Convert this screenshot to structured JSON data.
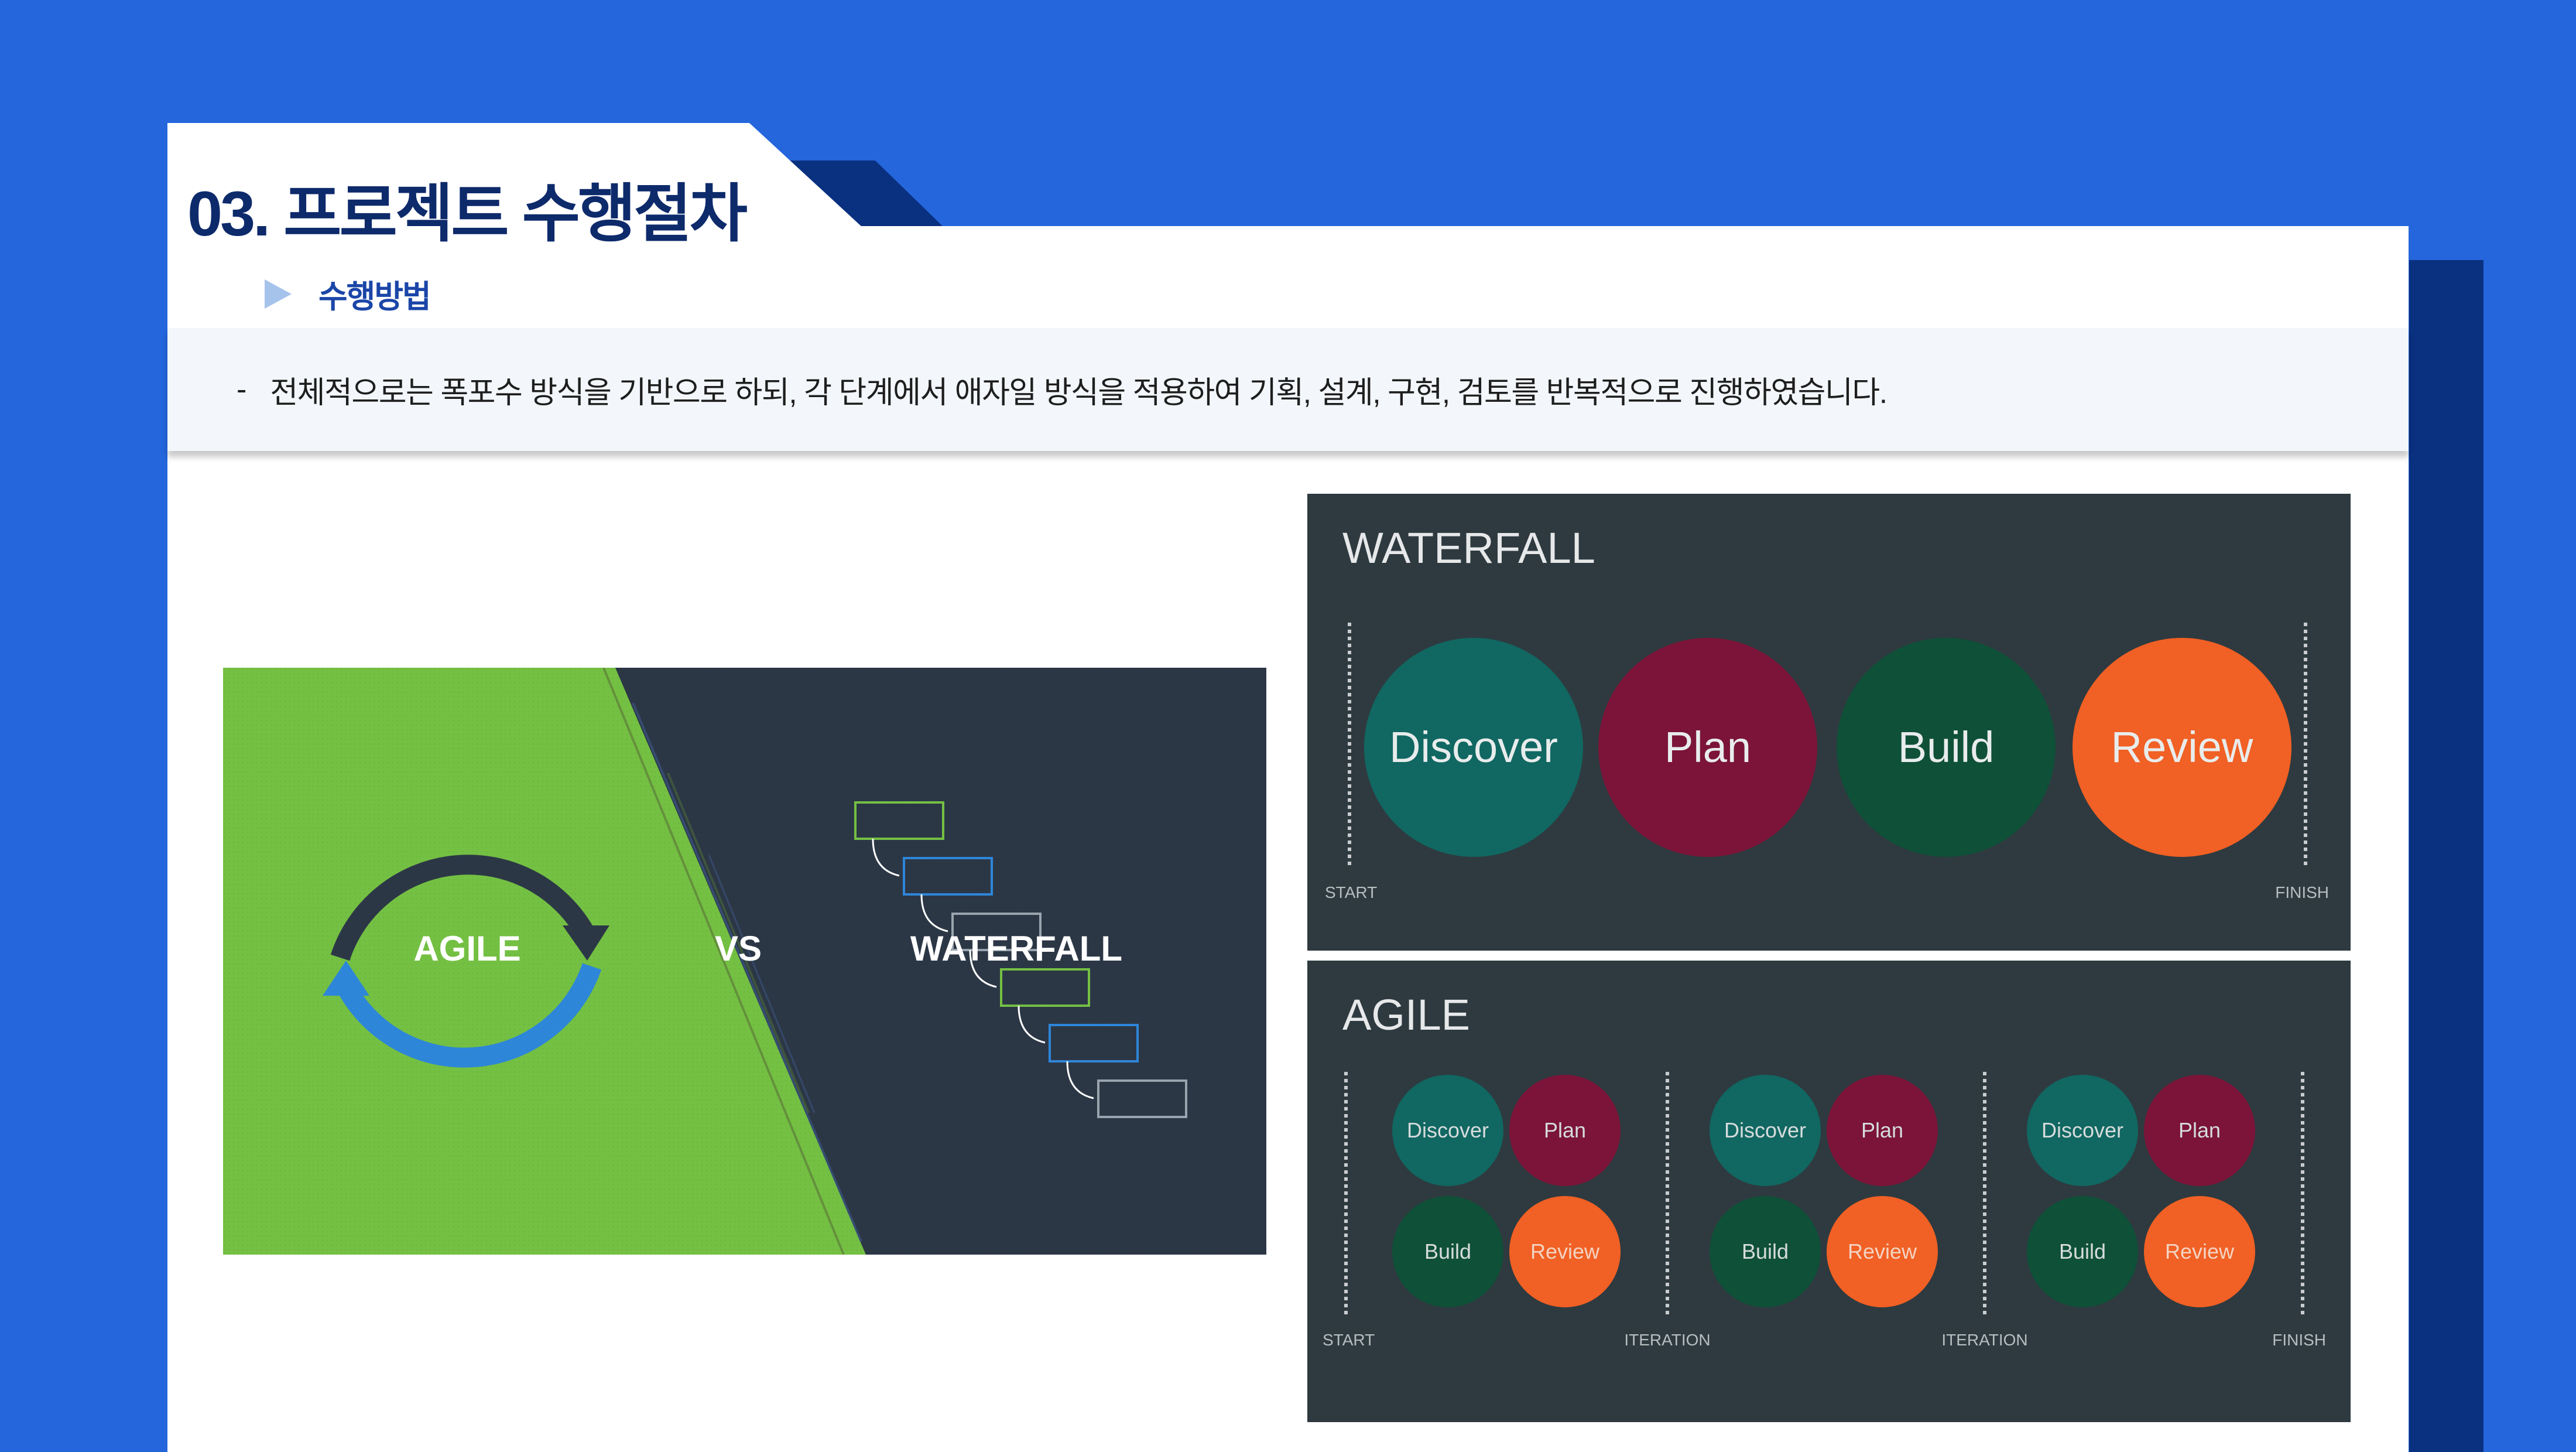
{
  "header": {
    "title": "03. 프로젝트 수행절차",
    "subtitle": "수행방법"
  },
  "description": {
    "bullet": "-",
    "text": "전체적으로는 폭포수 방식을 기반으로 하되, 각 단계에서 애자일 방식을 적용하여 기획, 설계, 구현, 검토를 반복적으로 진행하였습니다."
  },
  "agile_vs_waterfall_image": {
    "left_label": "AGILE",
    "middle_label": "VS",
    "right_label": "WATERFALL",
    "colors": {
      "green": "#74C043",
      "dark": "#2C3746",
      "cycle_dark": "#2C3746",
      "cycle_blue": "#2E86D9"
    }
  },
  "waterfall_panel": {
    "title": "WATERFALL",
    "start_label": "START",
    "finish_label": "FINISH",
    "phases": [
      {
        "name": "Discover",
        "color": "#116762"
      },
      {
        "name": "Plan",
        "color": "#7B1438"
      },
      {
        "name": "Build",
        "color": "#0F5038"
      },
      {
        "name": "Review",
        "color": "#F16024"
      }
    ]
  },
  "agile_panel": {
    "title": "AGILE",
    "markers": [
      "START",
      "ITERATION",
      "ITERATION",
      "FINISH"
    ],
    "iterations": [
      {
        "discover": "Discover",
        "plan": "Plan",
        "build": "Build",
        "review": "Review"
      },
      {
        "discover": "Discover",
        "plan": "Plan",
        "build": "Build",
        "review": "Review"
      },
      {
        "discover": "Discover",
        "plan": "Plan",
        "build": "Build",
        "review": "Review"
      }
    ]
  },
  "colors": {
    "background_blue": "#2566DD",
    "navy": "#0A317F",
    "panel_bg": "#2E3A3F"
  }
}
